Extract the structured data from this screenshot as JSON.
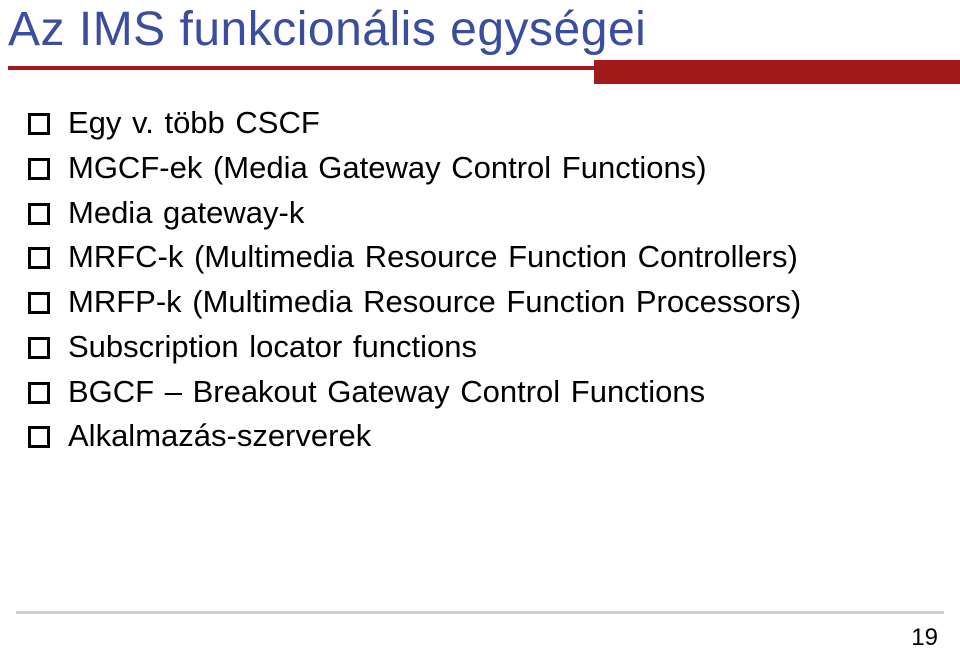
{
  "title": "Az IMS funkcionális egységei",
  "bullets": [
    "Egy v. több CSCF",
    "MGCF-ek (Media Gateway Control Functions)",
    "Media gateway-k",
    "MRFC-k (Multimedia Resource Function Controllers)",
    "MRFP-k (Multimedia Resource Function Processors)",
    "Subscription locator functions",
    "BGCF – Breakout Gateway Control Functions",
    "Alkalmazás-szerverek"
  ],
  "page_number": "19",
  "colors": {
    "title": "#3a4d9e",
    "rule": "#a31a1a",
    "footer_rule": "#cfcfcf"
  }
}
